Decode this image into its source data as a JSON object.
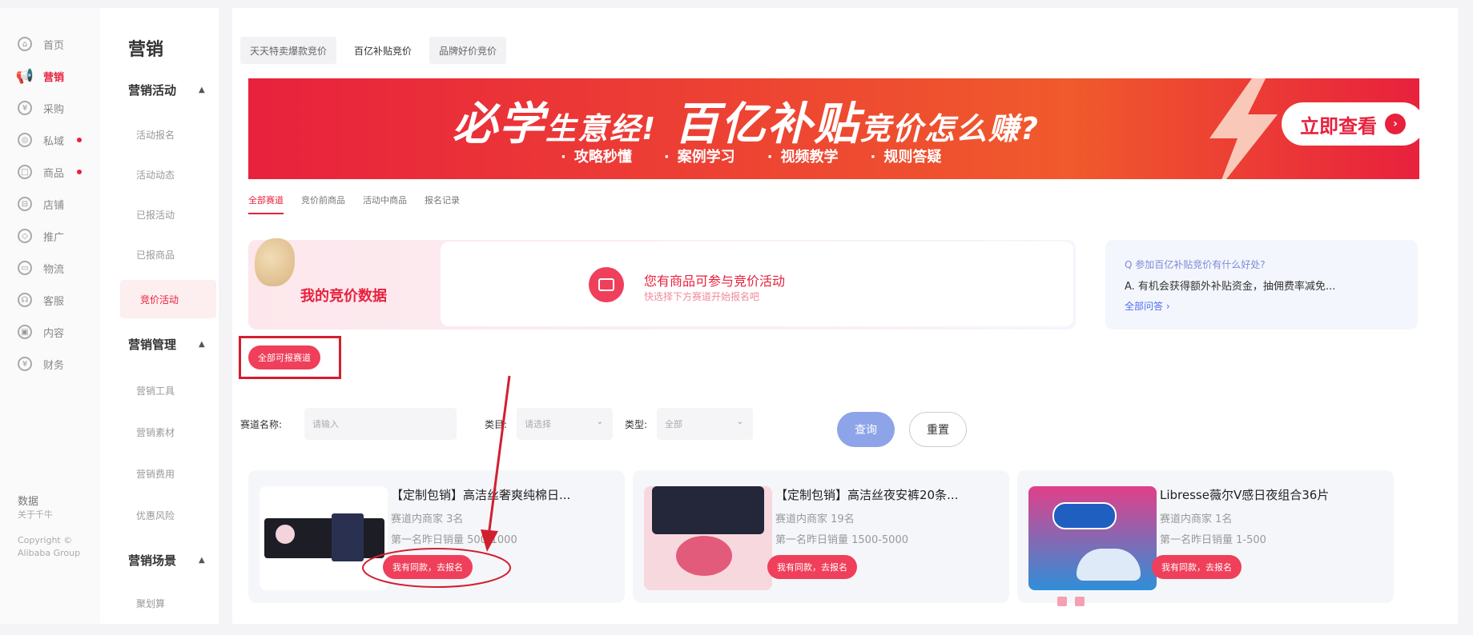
{
  "rail": {
    "items": [
      {
        "label": "首页",
        "icon": "home-icon",
        "dot": false
      },
      {
        "label": "营销",
        "icon": "megaphone-icon",
        "dot": false
      },
      {
        "label": "采购",
        "icon": "purchase-icon",
        "dot": false
      },
      {
        "label": "私域",
        "icon": "private-domain-icon",
        "dot": true
      },
      {
        "label": "商品",
        "icon": "goods-icon",
        "dot": true
      },
      {
        "label": "店铺",
        "icon": "store-icon",
        "dot": false
      },
      {
        "label": "推广",
        "icon": "promotion-icon",
        "dot": false
      },
      {
        "label": "物流",
        "icon": "logistics-icon",
        "dot": false
      },
      {
        "label": "客服",
        "icon": "customer-service-icon",
        "dot": false
      },
      {
        "label": "内容",
        "icon": "content-icon",
        "dot": false
      },
      {
        "label": "财务",
        "icon": "finance-icon",
        "dot": false
      }
    ],
    "footer": {
      "data_label": "数据",
      "about": "关于千牛",
      "copyright": "Copyright © Alibaba Group"
    }
  },
  "sidebar": {
    "title": "营销",
    "group_activity": "营销活动",
    "activity_items": [
      "活动报名",
      "活动动态",
      "已报活动",
      "已报商品",
      "竞价活动"
    ],
    "group_manage": "营销管理",
    "manage_items": [
      "营销工具",
      "营销素材",
      "营销费用",
      "优惠风险"
    ],
    "group_scene": "营销场景",
    "scene_items": [
      "聚划算"
    ]
  },
  "toptabs": [
    "天天特卖爆款竞价",
    "百亿补贴竞价",
    "品牌好价竞价"
  ],
  "banner": {
    "headline_a": "必学",
    "headline_b": "生意经!",
    "headline_c": "百亿补贴",
    "headline_d": "竞价怎么赚?",
    "points": [
      "攻略秒懂",
      "案例学习",
      "视频教学",
      "规则答疑"
    ],
    "cta": "立即查看"
  },
  "subtabs": [
    "全部赛道",
    "竞价前商品",
    "活动中商品",
    "报名记录"
  ],
  "panel": {
    "mydata": "我的竞价数据",
    "line1": "您有商品可参与竞价活动",
    "line2": "快选择下方赛道开始报名吧"
  },
  "faq": {
    "question": "Q 参加百亿补贴竞价有什么好处?",
    "answer": "A. 有机会获得额外补贴资金，抽佣费率减免...",
    "more": "全部问答 ›"
  },
  "all_button": "全部可报赛道",
  "filters": {
    "name_label": "赛道名称:",
    "name_placeholder": "请输入",
    "cat_label": "类目:",
    "cat_value": "请选择",
    "type_label": "类型:",
    "type_value": "全部",
    "query": "查询",
    "reset": "重置"
  },
  "cards": [
    {
      "name": "【定制包销】高洁丝奢爽纯棉日...",
      "meta1": "赛道内商家 3名",
      "meta2": "第一名昨日销量 500-1000",
      "button": "我有同款，去报名"
    },
    {
      "name": "【定制包销】高洁丝夜安裤20条...",
      "meta1": "赛道内商家 19名",
      "meta2": "第一名昨日销量 1500-5000",
      "button": "我有同款，去报名"
    },
    {
      "name": "Libresse薇尔V感日夜组合36片",
      "meta1": "赛道内商家 1名",
      "meta2": "第一名昨日销量 1-500",
      "button": "我有同款，去报名"
    }
  ],
  "colors": {
    "accent": "#e8213d",
    "query_btn": "#8ea4e8",
    "annotation": "#d21f2f"
  }
}
